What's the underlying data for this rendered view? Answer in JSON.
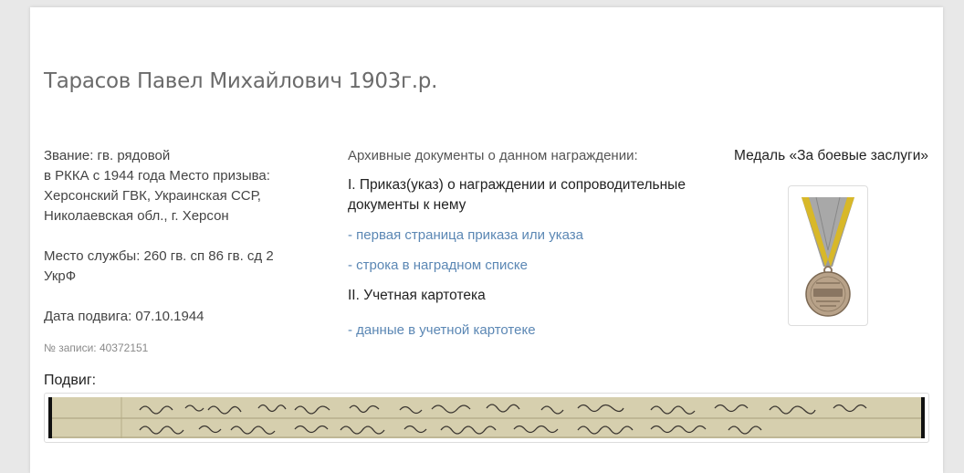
{
  "person": {
    "title": "Тарасов Павел Михайлович 1903г.р."
  },
  "details": {
    "rank_line1": "Звание: гв. рядовой",
    "rank_line2": "в РККА с 1944 года Место призыва:",
    "rank_line3": "Херсонский ГВК, Украинская ССР,",
    "rank_line4": "Николаевская обл., г. Херсон",
    "service_line1": "Место службы: 260 гв. сп 86 гв. сд 2",
    "service_line2": "УкрФ",
    "feat_date": "Дата подвига: 07.10.1944",
    "record_number": "№ записи: 40372151"
  },
  "documents": {
    "heading": "Архивные документы о данном награждении:",
    "section1_line1": "I. Приказ(указ) о награждении и сопроводительные",
    "section1_line2": "документы к нему",
    "link_first_page": "- первая страница приказа или указа",
    "link_award_list": "- строка в наградном списке",
    "section2": "II. Учетная картотека",
    "link_card_data": "- данные в учетной картотеке"
  },
  "medal": {
    "title": "Медаль «За боевые заслуги»"
  },
  "feat": {
    "label": "Подвиг:"
  },
  "colors": {
    "link": "#5b87b4",
    "title": "#6b6b6b",
    "background": "#e8e8e8"
  }
}
